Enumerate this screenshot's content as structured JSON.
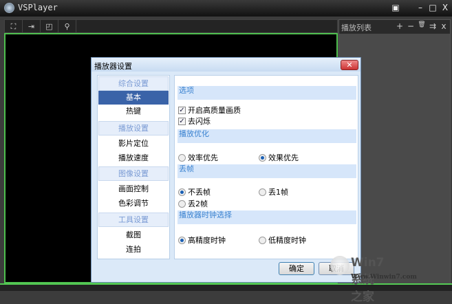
{
  "app": {
    "title": "VSPlayer",
    "buttons": [
      "▣",
      "–",
      "□",
      "X"
    ]
  },
  "toolbar": {
    "icons": [
      "fullscreen-icon",
      "pin-icon",
      "capture-icon",
      "zoom-icon"
    ],
    "glyphs": [
      "⛶",
      "⇥",
      "◰",
      "⚲"
    ]
  },
  "playlist": {
    "title": "播放列表",
    "buttons": [
      "+",
      "−",
      "🗑",
      "⇉",
      "x"
    ]
  },
  "dialog": {
    "title": "播放器设置",
    "close": "✕",
    "nav": [
      {
        "type": "header",
        "label": "综合设置"
      },
      {
        "type": "item",
        "label": "基本",
        "selected": true
      },
      {
        "type": "item",
        "label": "热键"
      },
      {
        "type": "header",
        "label": "播放设置"
      },
      {
        "type": "item",
        "label": "影片定位"
      },
      {
        "type": "item",
        "label": "播放速度"
      },
      {
        "type": "header",
        "label": "图像设置"
      },
      {
        "type": "item",
        "label": "画面控制"
      },
      {
        "type": "item",
        "label": "色彩调节"
      },
      {
        "type": "header",
        "label": "工具设置"
      },
      {
        "type": "item",
        "label": "截图"
      },
      {
        "type": "item",
        "label": "连拍"
      }
    ],
    "sections": {
      "options": "选项",
      "hq": "开启高质量画质",
      "deflicker": "去闪烁",
      "optimize": "播放优化",
      "efficiency": "效率优先",
      "quality": "效果优先",
      "dropframe": "丢帧",
      "nodrop": "不丢帧",
      "drop1": "丢1帧",
      "drop2": "丢2帧",
      "clock": "播放器时钟选择",
      "hiclock": "高精度时钟",
      "loclock": "低精度时钟"
    },
    "ok": "确定",
    "cancel": "取消"
  },
  "watermark": {
    "line1": "Win7系统之家",
    "line2": "Www.Winwin7.com"
  }
}
